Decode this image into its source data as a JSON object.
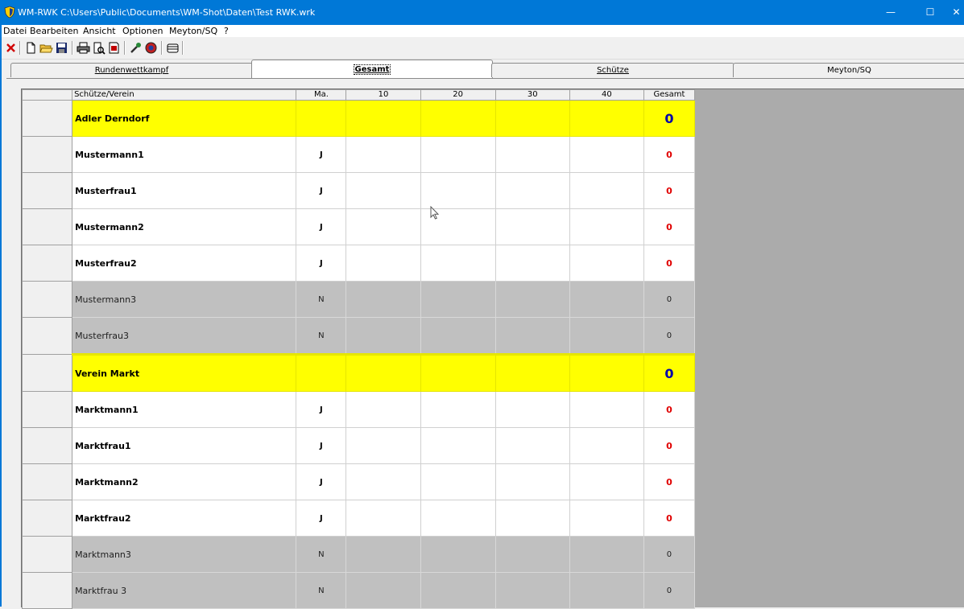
{
  "window": {
    "title": "WM-RWK C:\\Users\\Public\\Documents\\WM-Shot\\Daten\\Test RWK.wrk",
    "minimize_glyph": "—",
    "maximize_glyph": "☐",
    "close_glyph": "✕"
  },
  "menu": [
    "Datei",
    "Bearbeiten",
    "Ansicht",
    "Optionen",
    "Meyton/SQ",
    "?"
  ],
  "toolbar": {
    "icons": [
      "close-icon",
      "new-file-icon",
      "open-folder-icon",
      "save-icon",
      "print-icon",
      "print-preview-icon",
      "export-pdf-icon",
      "tools-icon",
      "globe-icon",
      "card-icon"
    ]
  },
  "tabs": [
    {
      "label": "Rundenwettkampf",
      "active": false
    },
    {
      "label": "Gesamt",
      "active": true
    },
    {
      "label": "Schütze",
      "active": false
    },
    {
      "label": "Meyton/SQ",
      "active": false
    }
  ],
  "grid": {
    "headers": [
      "Schütze/Verein",
      "Ma.",
      "10",
      "20",
      "30",
      "40",
      "Gesamt"
    ],
    "rows": [
      {
        "type": "club",
        "name": "Adler Derndorf",
        "ma": "",
        "total": "0"
      },
      {
        "type": "active",
        "name": "Mustermann1",
        "ma": "J",
        "total": "0"
      },
      {
        "type": "active",
        "name": "Musterfrau1",
        "ma": "J",
        "total": "0"
      },
      {
        "type": "active",
        "name": "Mustermann2",
        "ma": "J",
        "total": "0"
      },
      {
        "type": "active",
        "name": "Musterfrau2",
        "ma": "J",
        "total": "0"
      },
      {
        "type": "inactive",
        "name": "Mustermann3",
        "ma": "N",
        "total": "0"
      },
      {
        "type": "inactive",
        "name": "Musterfrau3",
        "ma": "N",
        "total": "0"
      },
      {
        "type": "club",
        "name": "Verein Markt",
        "ma": "",
        "total": "0"
      },
      {
        "type": "active",
        "name": "Marktmann1",
        "ma": "J",
        "total": "0"
      },
      {
        "type": "active",
        "name": "Marktfrau1",
        "ma": "J",
        "total": "0"
      },
      {
        "type": "active",
        "name": "Marktmann2",
        "ma": "J",
        "total": "0"
      },
      {
        "type": "active",
        "name": "Marktfrau2",
        "ma": "J",
        "total": "0"
      },
      {
        "type": "inactive",
        "name": "Marktmann3",
        "ma": "N",
        "total": "0"
      },
      {
        "type": "inactive",
        "name": "Marktfrau 3",
        "ma": "N",
        "total": "0"
      }
    ]
  },
  "colors": {
    "titlebar": "#0078d7",
    "club_row": "#ffff00",
    "club_total": "#0000aa",
    "active_total": "#e00000",
    "inactive_row": "#c0c0c0",
    "empty_area": "#ababab"
  }
}
